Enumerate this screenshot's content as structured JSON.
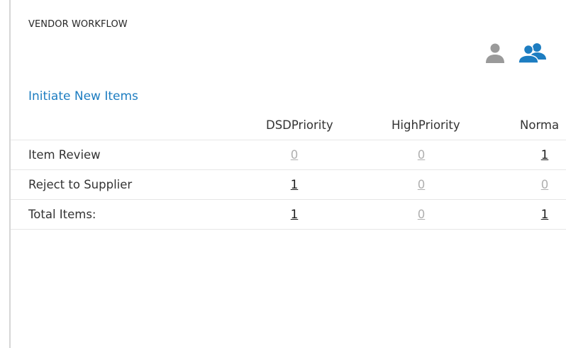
{
  "panel": {
    "title": "VENDOR WORKFLOW"
  },
  "view_toggle": {
    "single_icon": "single-user-icon",
    "group_icon": "group-icon",
    "single_color": "#9a9a9a",
    "group_color": "#1d7dc1",
    "selected": "group"
  },
  "section": {
    "title": "Initiate New Items"
  },
  "table": {
    "columns": [
      "DSDPriority",
      "HighPriority",
      "Norma"
    ],
    "rows": [
      {
        "label": "Item Review",
        "values": [
          "0",
          "0",
          "1"
        ]
      },
      {
        "label": "Reject to Supplier",
        "values": [
          "1",
          "0",
          "0"
        ]
      },
      {
        "label": "Total Items:",
        "values": [
          "1",
          "0",
          "1"
        ]
      }
    ]
  },
  "colors": {
    "accent": "#1d7dc1",
    "active_count": "#1a1a1a",
    "zero_count": "#b0b0b0"
  }
}
